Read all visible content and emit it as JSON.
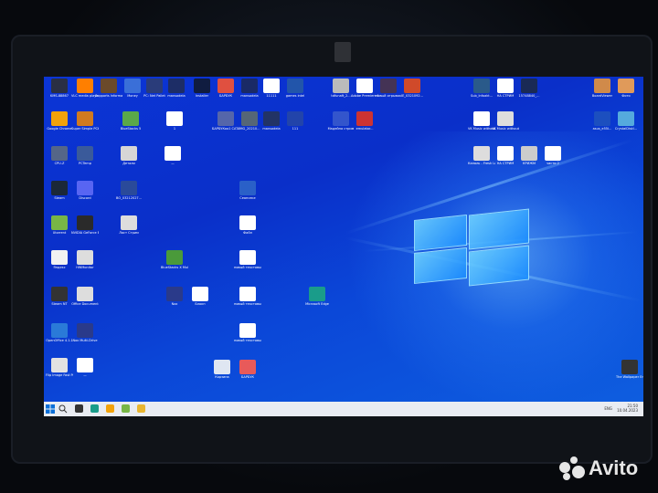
{
  "desktop": {
    "icons": [
      {
        "id": "i1",
        "label": "KMS-88867",
        "color": "#2a2f44"
      },
      {
        "id": "i2",
        "label": "VLC media player",
        "color": "#ff7f00"
      },
      {
        "id": "i3",
        "label": "Supports Informat.",
        "color": "#6b4a2a"
      },
      {
        "id": "i4",
        "label": "Money",
        "color": "#3a6fd8"
      },
      {
        "id": "i5",
        "label": "PC: Net Pallet",
        "color": "#2a3c7a"
      },
      {
        "id": "i6",
        "label": "mansodela",
        "color": "#1d2d66"
      },
      {
        "id": "i7",
        "label": "Installer",
        "color": "#101c40"
      },
      {
        "id": "i8",
        "label": "БАРБУК",
        "color": "#e05040"
      },
      {
        "id": "i9",
        "label": "mansodela",
        "color": "#1a2a66"
      },
      {
        "id": "i10",
        "label": "11111",
        "color": "#ffffff"
      },
      {
        "id": "i11",
        "label": "games intel",
        "color": "#2255aa"
      },
      {
        "id": "i12",
        "label": "tdfunaft_2...",
        "color": "#bbbbbb"
      },
      {
        "id": "i13",
        "label": "Adobe Premiere P...",
        "color": "#ffffff"
      },
      {
        "id": "i14",
        "label": "новый отрывок",
        "color": "#443355"
      },
      {
        "id": "i15",
        "label": "IE_0321092...",
        "color": "#d04a2a"
      },
      {
        "id": "i16",
        "label": "Sub_Infoakt...",
        "color": "#2a5a8a"
      },
      {
        "id": "i17",
        "label": "НА СТРИМ",
        "color": "#ffffff"
      },
      {
        "id": "i18",
        "label": "15748840_...",
        "color": "#1a2a55"
      },
      {
        "id": "i19",
        "label": "BoardViewer",
        "color": "#d08a4a"
      },
      {
        "id": "i20",
        "label": "Фото",
        "color": "#e09a5a"
      },
      {
        "id": "i21",
        "label": "Google Chrome",
        "color": "#f2a20a"
      },
      {
        "id": "i22",
        "label": "Super Simple PCtools",
        "color": "#d07a20"
      },
      {
        "id": "i23",
        "label": "BlueStacks 5",
        "color": "#5aa84a"
      },
      {
        "id": "i24",
        "label": "1",
        "color": "#ffffff"
      },
      {
        "id": "i25",
        "label": "БАРБУКоо1 CATA",
        "color": "#5566aa"
      },
      {
        "id": "i26",
        "label": "IMG_20210...",
        "color": "#556677"
      },
      {
        "id": "i27",
        "label": "mansodela",
        "color": "#223366"
      },
      {
        "id": "i28",
        "label": "111",
        "color": "#2244aa"
      },
      {
        "id": "i29",
        "label": "Мадейна стрим",
        "color": "#3355cc"
      },
      {
        "id": "i30",
        "label": "emulator...",
        "color": "#cc3333"
      },
      {
        "id": "i31",
        "label": "VK Music without co...",
        "color": "#ffffff"
      },
      {
        "id": "i32",
        "label": "VK Music without co...",
        "color": "#dddddd"
      },
      {
        "id": "i33",
        "label": "asus_e55l...",
        "color": "#1c4fbf"
      },
      {
        "id": "i34",
        "label": "CrystalDiskI...",
        "color": "#55aadd"
      },
      {
        "id": "i35",
        "label": "CPU-Z",
        "color": "#556688"
      },
      {
        "id": "i36",
        "label": "PCTemp",
        "color": "#3a5a9a"
      },
      {
        "id": "i37",
        "label": "Детали",
        "color": "#d6d6d6"
      },
      {
        "id": "i38",
        "label": "—",
        "color": "#ffffff"
      },
      {
        "id": "i39",
        "label": "Каналь - Fresh Love (ft Re...",
        "color": "#dddddd"
      },
      {
        "id": "i40",
        "label": "НА СТРИМ",
        "color": "#ffffff"
      },
      {
        "id": "i41",
        "label": "КРИЖМ",
        "color": "#cccccc"
      },
      {
        "id": "i42",
        "label": "части 2",
        "color": "#ffffff"
      },
      {
        "id": "i43",
        "label": "Steam",
        "color": "#1b2838"
      },
      {
        "id": "i44",
        "label": "Discord",
        "color": "#5865f2"
      },
      {
        "id": "i45",
        "label": "BO_03212027...",
        "color": "#2a4a9a"
      },
      {
        "id": "i46",
        "label": "Сеансеке",
        "color": "#2a60c8"
      },
      {
        "id": "i47",
        "label": "Utorrent",
        "color": "#78b646"
      },
      {
        "id": "i48",
        "label": "NVIDIA GeForce Experience",
        "color": "#2a2a2a"
      },
      {
        "id": "i49",
        "label": "Ласт Стрим",
        "color": "#dddddd"
      },
      {
        "id": "i50",
        "label": "Файл",
        "color": "#ffffff"
      },
      {
        "id": "i51",
        "label": "Яндекс",
        "color": "#f2f2f2"
      },
      {
        "id": "i52",
        "label": "HWMonitor",
        "color": "#dddddd"
      },
      {
        "id": "i53",
        "label": "BlueStacks X Multi-Instan...",
        "color": "#4a9a3a"
      },
      {
        "id": "i54",
        "label": "новый текстовый...",
        "color": "#ffffff"
      },
      {
        "id": "i55",
        "label": "Steam NT",
        "color": "#333333"
      },
      {
        "id": "i56",
        "label": "Office Document",
        "color": "#dddddd"
      },
      {
        "id": "i57",
        "label": "Nox",
        "color": "#2a3a8a"
      },
      {
        "id": "i58",
        "label": "Блокн",
        "color": "#ffffff"
      },
      {
        "id": "i59",
        "label": "новый текстовый...",
        "color": "#ffffff"
      },
      {
        "id": "i60",
        "label": "новый текстовый...",
        "color": "#ffffff"
      },
      {
        "id": "i61",
        "label": "Microsoft Edge",
        "color": "#1a9c8a"
      },
      {
        "id": "i62",
        "label": "OpenOffice 4.1.1",
        "color": "#2a7ad8"
      },
      {
        "id": "i63",
        "label": "Nox Multi-Drive",
        "color": "#2a3a8a"
      },
      {
        "id": "i64",
        "label": "БАРБУК",
        "color": "#e85a5a"
      },
      {
        "id": "i65",
        "label": "Корзина",
        "color": "#dfe6f2"
      },
      {
        "id": "i66",
        "label": "The Wallpaper Engine Fallout Pro",
        "color": "#333333"
      },
      {
        "id": "i67",
        "label": "Flip Image Fast Pro",
        "color": "#e2e2e2"
      },
      {
        "id": "i68",
        "label": "—",
        "color": "#ffffff"
      }
    ]
  },
  "taskbar": {
    "search_icon": "search-icon",
    "apps": [
      {
        "name": "taskview",
        "color": "#333333"
      },
      {
        "name": "edge",
        "color": "#1a9c8a"
      },
      {
        "name": "chrome",
        "color": "#f2a20a"
      },
      {
        "name": "utorrent",
        "color": "#78b646"
      },
      {
        "name": "explorer",
        "color": "#e8b530"
      }
    ],
    "lang": "ENG",
    "time": "21:50",
    "date": "10.04.2023"
  },
  "watermark": {
    "brand": "Avito"
  }
}
